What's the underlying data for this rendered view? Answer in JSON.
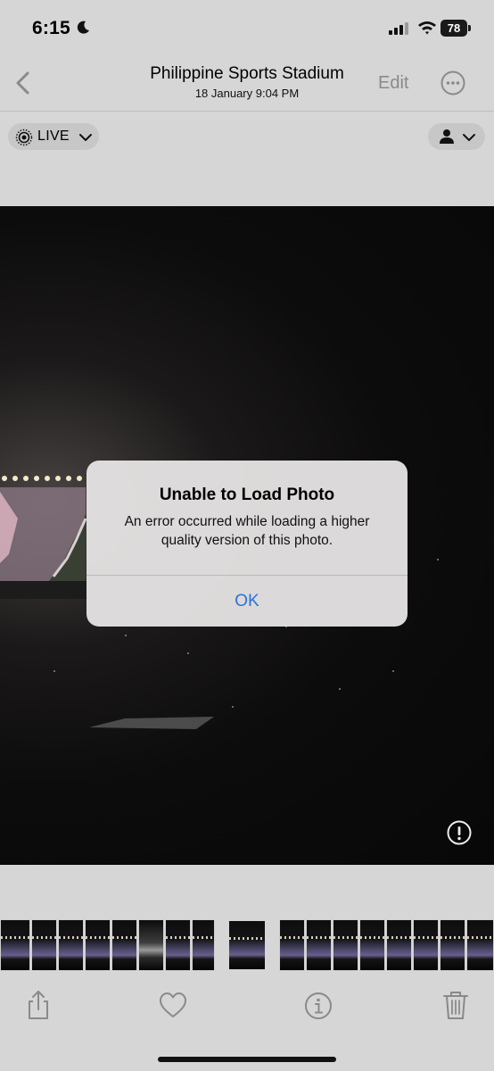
{
  "status_bar": {
    "time": "6:15",
    "battery": "78",
    "icons": [
      "moon-icon",
      "cellular-signal-icon",
      "wifi-icon",
      "battery-icon"
    ]
  },
  "nav": {
    "title": "Philippine Sports Stadium",
    "subtitle": "18 January  9:04 PM",
    "edit_label": "Edit",
    "icons": [
      "chevron-left-icon",
      "ellipsis-circle-icon"
    ]
  },
  "live": {
    "label": "LIVE",
    "icons": [
      "live-photo-icon",
      "chevron-down-icon"
    ]
  },
  "people": {
    "icons": [
      "person-icon",
      "chevron-down-icon"
    ]
  },
  "dialog": {
    "title": "Unable to Load Photo",
    "message": "An error occurred while loading a higher quality version of this photo.",
    "ok_label": "OK"
  },
  "toolbar": {
    "icons": [
      "share-icon",
      "heart-icon",
      "info-icon",
      "trash-icon"
    ]
  },
  "colors": {
    "accent": "#2b72d9",
    "background": "#d6d6d6",
    "dialog": "#e4e2e2"
  }
}
